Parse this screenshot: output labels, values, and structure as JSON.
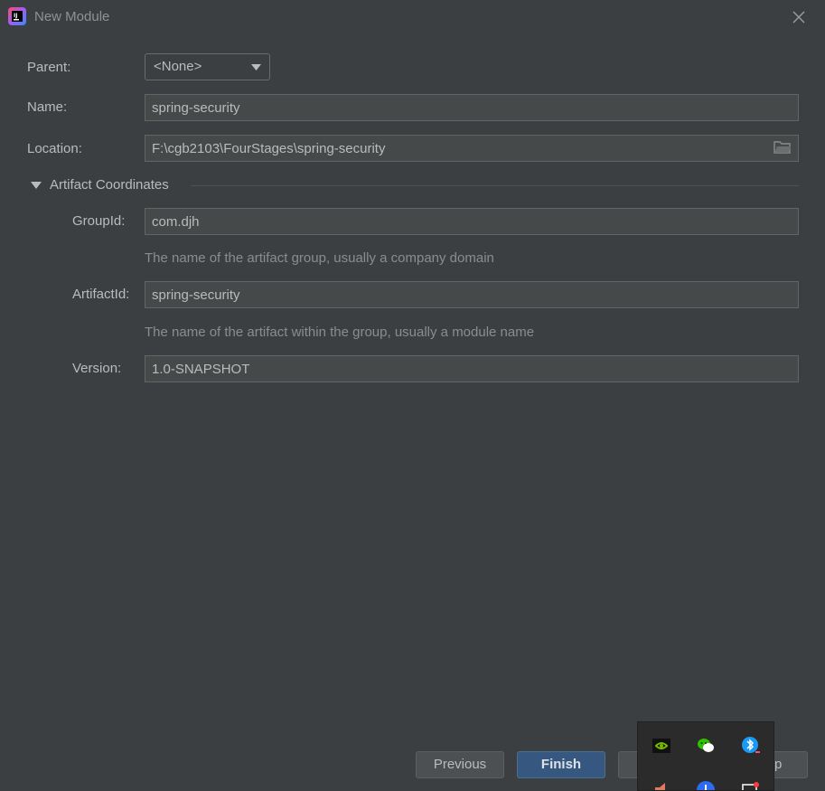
{
  "window": {
    "title": "New Module",
    "app_icon": "intellij-idea-icon",
    "close_icon": "close-icon"
  },
  "form": {
    "parent": {
      "label": "Parent:",
      "value": "<None>"
    },
    "name": {
      "label": "Name:",
      "value": "spring-security"
    },
    "location": {
      "label": "Location:",
      "value": "F:\\cgb2103\\FourStages\\spring-security",
      "icon": "folder-icon"
    }
  },
  "artifact": {
    "section_title": "Artifact Coordinates",
    "group_id": {
      "label": "GroupId:",
      "value": "com.djh",
      "hint": "The name of the artifact group, usually a company domain"
    },
    "artifact_id": {
      "label": "ArtifactId:",
      "value": "spring-security",
      "hint": "The name of the artifact within the group, usually a module name"
    },
    "version": {
      "label": "Version:",
      "value": "1.0-SNAPSHOT"
    }
  },
  "buttons": {
    "previous": "Previous",
    "finish": "Finish",
    "help_partial": "p"
  },
  "tray": {
    "icons": [
      "nvidia-icon",
      "wechat-icon",
      "bluetooth-icon",
      "volume-icon",
      "info-icon",
      "display-icon"
    ]
  },
  "colors": {
    "background": "#3c3f41",
    "field_background": "#45494a",
    "primary_button": "#365880",
    "tray_background": "#2b2b2b"
  }
}
